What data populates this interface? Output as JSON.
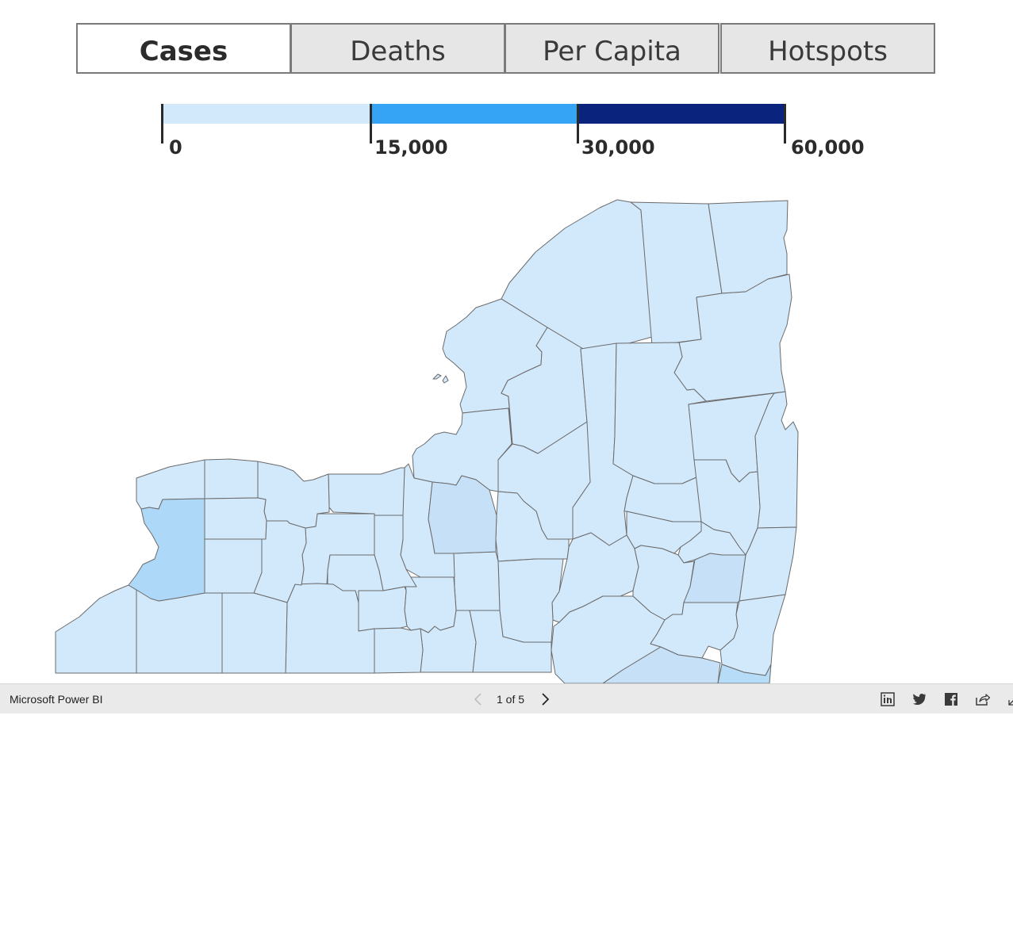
{
  "tabs": [
    {
      "label": "Cases",
      "active": true
    },
    {
      "label": "Deaths",
      "active": false
    },
    {
      "label": "Per Capita",
      "active": false
    },
    {
      "label": "Hotspots",
      "active": false
    }
  ],
  "legend": {
    "labels": [
      "0",
      "15,000",
      "30,000",
      "60,000"
    ],
    "colors": [
      "#d2e8fb",
      "#35a4f4",
      "#0a237c"
    ]
  },
  "map": {
    "region_fill_default": "#d2e8fb",
    "region_fill_highlight": "#aed8f7",
    "region_fill_medium": "#c6e1f7"
  },
  "footer": {
    "brand": "Microsoft Power BI",
    "page_indicator": "1 of 5",
    "share_icons": [
      "linkedin-icon",
      "twitter-icon",
      "facebook-icon",
      "share-icon",
      "expand-icon"
    ]
  }
}
